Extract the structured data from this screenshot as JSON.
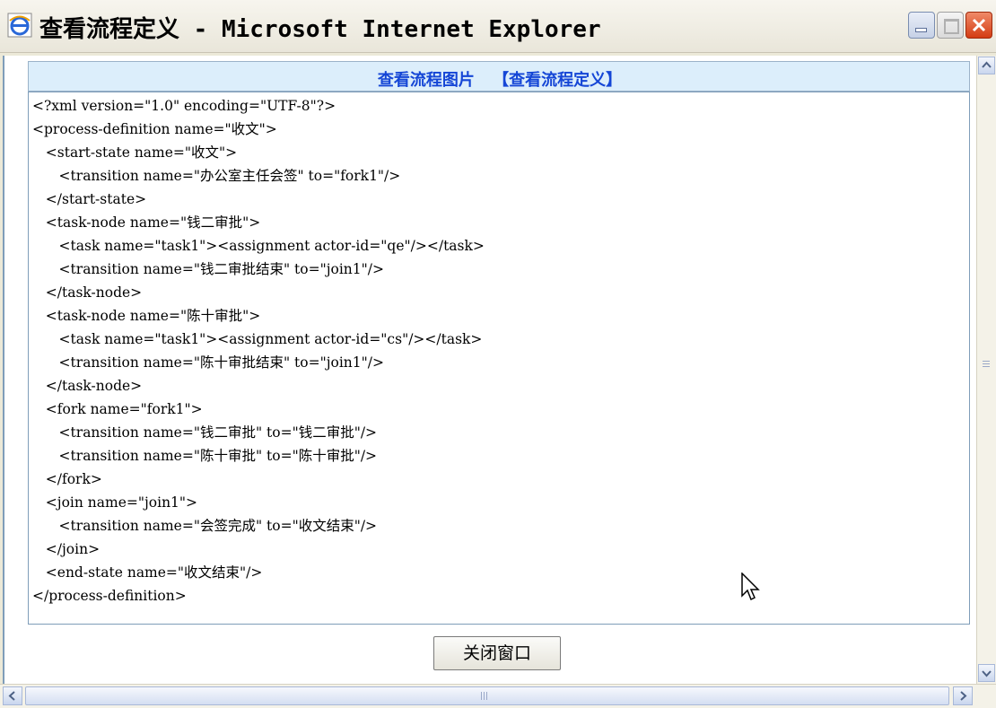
{
  "window": {
    "title": "查看流程定义 - Microsoft Internet Explorer",
    "icon": "ie-icon"
  },
  "header": {
    "link_label": "查看流程图片",
    "current_label": "【查看流程定义】"
  },
  "xml_lines": [
    "<?xml version=\"1.0\" encoding=\"UTF-8\"?>",
    "<process-definition name=\"收文\">",
    "   <start-state name=\"收文\">",
    "      <transition name=\"办公室主任会签\" to=\"fork1\"/>",
    "   </start-state>",
    "   <task-node name=\"钱二审批\">",
    "      <task name=\"task1\"><assignment actor-id=\"qe\"/></task>",
    "      <transition name=\"钱二审批结束\" to=\"join1\"/>",
    "   </task-node>",
    "   <task-node name=\"陈十审批\">",
    "      <task name=\"task1\"><assignment actor-id=\"cs\"/></task>",
    "      <transition name=\"陈十审批结束\" to=\"join1\"/>",
    "   </task-node>",
    "   <fork name=\"fork1\">",
    "      <transition name=\"钱二审批\" to=\"钱二审批\"/>",
    "      <transition name=\"陈十审批\" to=\"陈十审批\"/>",
    "   </fork>",
    "   <join name=\"join1\">",
    "      <transition name=\"会签完成\" to=\"收文结束\"/>",
    "   </join>",
    "   <end-state name=\"收文结束\"/>",
    "</process-definition>"
  ],
  "buttons": {
    "close_window": "关闭窗口"
  }
}
